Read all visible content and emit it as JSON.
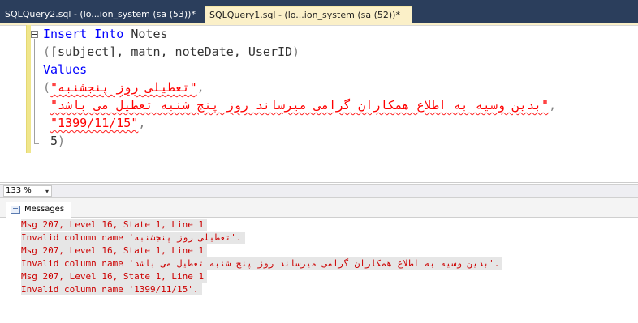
{
  "tabs": {
    "inactive_label": "SQLQuery2.sql - (lo...ion_system (sa (53))*",
    "active_label": "SQLQuery1.sql - (lo...ion_system (sa (52))*"
  },
  "editor": {
    "line1_kw1": "Insert",
    "line1_kw2": "Into",
    "line1_table": "Notes",
    "line2_open": "(",
    "line2_cols": "[subject], matn, noteDate, UserID",
    "line2_close": ")",
    "line3_kw": "Values",
    "line4_open": "(",
    "line4_str": "\"تعطیلی روز پنجشنبه\"",
    "line4_comma": ",",
    "line5_str": "\"بدین وسیه به اطلاع همکاران گرامی میرساند روز پنج شنبه تعطیل می باشد\"",
    "line5_comma": ",",
    "line6_str": "\"1399/11/15\"",
    "line6_comma": ",",
    "line7_num": "5",
    "line7_close": ")"
  },
  "zoom": {
    "value": "133 %",
    "arrow": "▾"
  },
  "results": {
    "tab_label": "Messages",
    "messages": [
      "Msg 207, Level 16, State 1, Line 1",
      "Invalid column name 'تعطیلی روز پنجشنبه'.",
      "Msg 207, Level 16, State 1, Line 1",
      "Invalid column name 'بدین وسیه به اطلاع همکاران گرامی میرساند روز پنج شنبه تعطیل می باشد'.",
      "Msg 207, Level 16, State 1, Line 1",
      "Invalid column name '1399/11/15'."
    ]
  },
  "colors": {
    "tab_strip": "#2b3e5c",
    "active_tab": "#fbf0c8",
    "keyword": "#0000ff",
    "string": "#ff0000",
    "error_text": "#cc0000"
  }
}
